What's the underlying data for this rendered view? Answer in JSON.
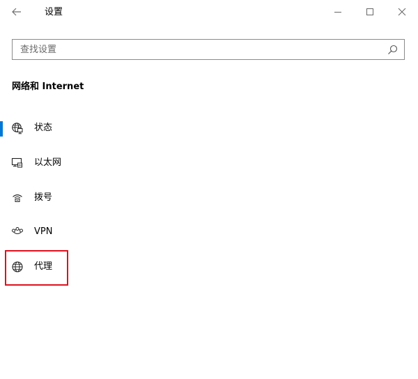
{
  "window": {
    "title": "设置"
  },
  "search": {
    "placeholder": "查找设置"
  },
  "section": {
    "heading": "网络和 Internet"
  },
  "nav": {
    "selected": "状态",
    "items": [
      {
        "label": "状态",
        "icon": "globe-network-icon"
      },
      {
        "label": "以太网",
        "icon": "ethernet-monitor-icon"
      },
      {
        "label": "拨号",
        "icon": "dialup-phone-icon"
      },
      {
        "label": "VPN",
        "icon": "vpn-icon"
      },
      {
        "label": "代理",
        "icon": "globe-icon"
      }
    ]
  },
  "annotation": {
    "highlighted_item": "代理",
    "color": "#e0101d"
  },
  "colors": {
    "accent": "#0078d7",
    "highlight": "#e0101d"
  }
}
